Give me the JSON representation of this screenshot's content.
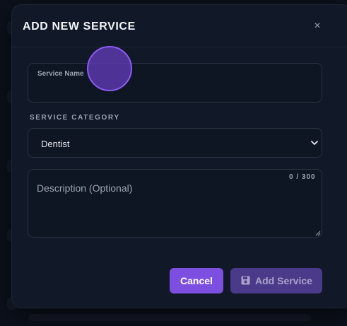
{
  "modal": {
    "title": "ADD NEW SERVICE",
    "close_glyph": "×",
    "close_icon": "close-icon"
  },
  "service_name": {
    "label": "Service Name",
    "value": ""
  },
  "service_category": {
    "label": "SERVICE CATEGORY",
    "selected": "Dentist",
    "icon": "chevron-down-icon"
  },
  "description": {
    "placeholder": "Description (Optional)",
    "value": "",
    "char_count": "0 / 300"
  },
  "actions": {
    "cancel_label": "Cancel",
    "add_label": "Add Service",
    "add_icon": "save-icon"
  },
  "colors": {
    "accent": "#7c4fe0",
    "accent_disabled": "#4b3a8a",
    "modal_bg": "#111827",
    "text": "#f3f4f6"
  }
}
